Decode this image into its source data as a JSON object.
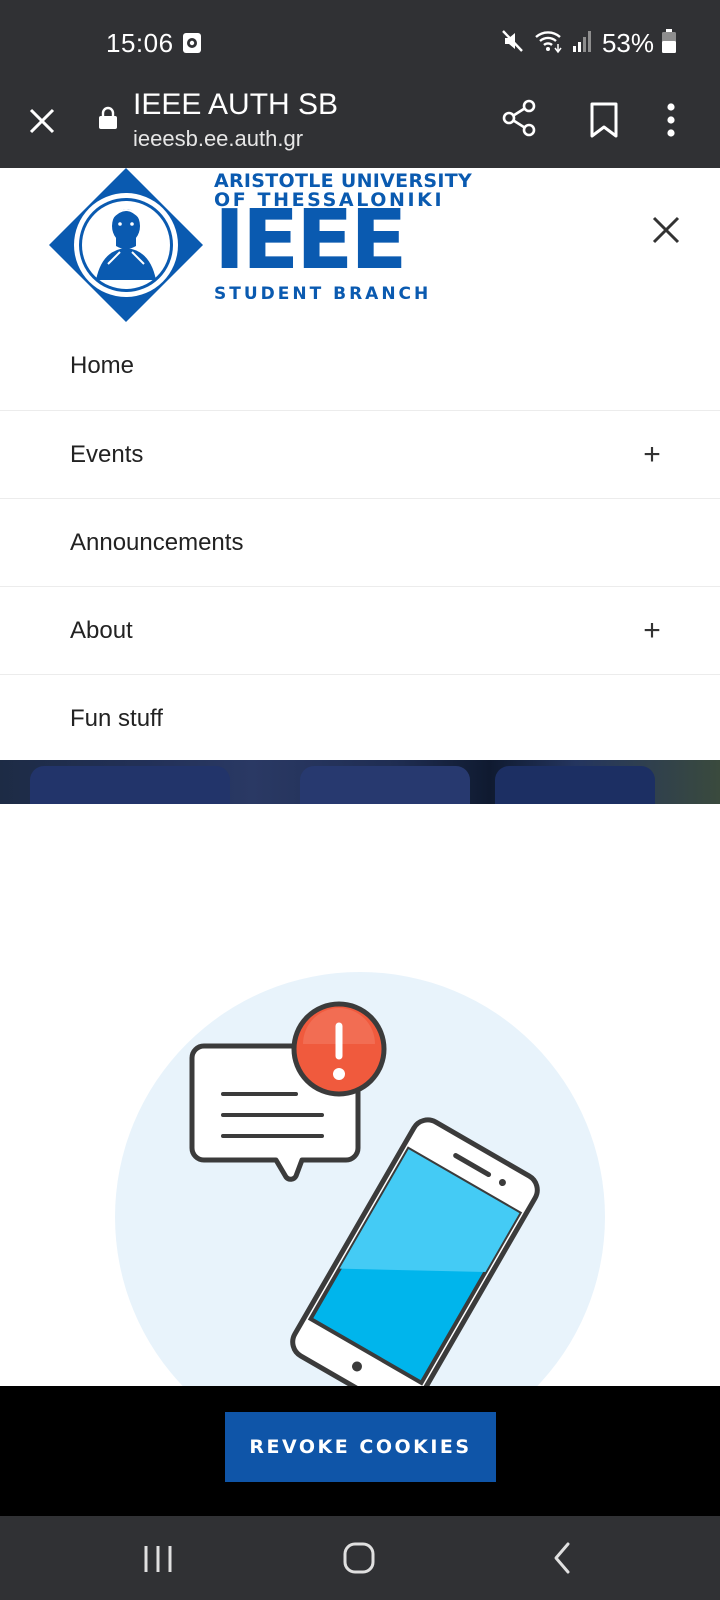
{
  "status_bar": {
    "time": "15:06",
    "battery": "53%",
    "icons": [
      "screen-record-icon",
      "mute-icon",
      "wifi-icon",
      "signal-icon",
      "battery-icon"
    ]
  },
  "browser": {
    "page_title": "IEEE AUTH SB",
    "url": "ieeesb.ee.auth.gr",
    "icons": [
      "close-icon",
      "lock-icon",
      "share-icon",
      "bookmark-icon",
      "more-vert-icon"
    ]
  },
  "logo": {
    "line1": "ARISTOTLE UNIVERSITY",
    "line2": "OF THESSALONIKI",
    "main": "IEEE",
    "line3": "STUDENT BRANCH",
    "brand_color": "#0a5ab0"
  },
  "menu": {
    "items": [
      {
        "label": "Home",
        "expandable": false
      },
      {
        "label": "Events",
        "expandable": true,
        "toggle": "+"
      },
      {
        "label": "Announcements",
        "expandable": false
      },
      {
        "label": "About",
        "expandable": true,
        "toggle": "+"
      },
      {
        "label": "Fun stuff",
        "expandable": false
      }
    ]
  },
  "cookie": {
    "button_label": "REVOKE COOKIES",
    "button_color": "#0f55a8"
  },
  "system_nav": {
    "icons": [
      "recents-icon",
      "home-icon",
      "back-icon"
    ]
  }
}
